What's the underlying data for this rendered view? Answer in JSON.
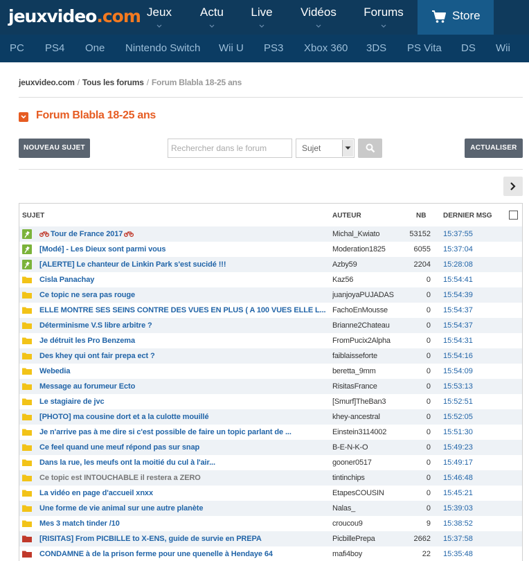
{
  "logo": {
    "main": "jeuxvideo",
    "accent": ".com"
  },
  "main_nav": [
    {
      "label": "Jeux"
    },
    {
      "label": "Actu"
    },
    {
      "label": "Live"
    },
    {
      "label": "Vidéos"
    },
    {
      "label": "Forums"
    }
  ],
  "store": {
    "label": "Store",
    "icon": "cart-icon"
  },
  "platforms": [
    "PC",
    "PS4",
    "One",
    "Nintendo Switch",
    "Wii U",
    "PS3",
    "Xbox 360",
    "3DS",
    "PS Vita",
    "DS",
    "Wii"
  ],
  "breadcrumb": {
    "home": "jeuxvideo.com",
    "forums": "Tous les forums",
    "current": "Forum Blabla 18-25 ans",
    "separator": "/"
  },
  "page_title": "Forum Blabla 18-25 ans",
  "toolbar": {
    "new_topic_label": "NOUVEAU SUJET",
    "search_placeholder": "Rechercher dans le forum",
    "search_scope": "Sujet",
    "refresh_label": "ACTUALISER"
  },
  "table": {
    "headers": {
      "subject": "SUJET",
      "author": "AUTEUR",
      "nb": "NB",
      "last": "DERNIER MSG"
    },
    "colors": {
      "pinned": "#7bb33a",
      "normal": "#f2c318",
      "hot": "#c0392b",
      "link": "#2265a8",
      "title_accent": "#e65c22"
    },
    "rows": [
      {
        "type": "pinned",
        "subject": "Tour de France 2017",
        "bike": true,
        "author": "Michal_Kwiato",
        "nb": "53152",
        "time": "15:37:55"
      },
      {
        "type": "pinned",
        "subject": "[Modé] - Les Dieux sont parmi vous",
        "author": "Moderation1825",
        "nb": "6055",
        "time": "15:37:04"
      },
      {
        "type": "pinned",
        "subject": "[ALERTE] Le chanteur de Linkin Park s'est sucidé !!!",
        "author": "Azby59",
        "nb": "2204",
        "time": "15:28:08"
      },
      {
        "type": "normal",
        "subject": "Cisla Panachay",
        "author": "Kaz56",
        "nb": "0",
        "time": "15:54:41"
      },
      {
        "type": "normal",
        "subject": "Ce topic ne sera pas rouge",
        "author": "juanjoyaPUJADAS",
        "nb": "0",
        "time": "15:54:39"
      },
      {
        "type": "normal",
        "subject": "ELLE MONTRE SES SEINS CONTRE DES VUES EN PLUS ( A 100 VUES ELLE L...",
        "author": "FachoEnMousse",
        "nb": "0",
        "time": "15:54:37"
      },
      {
        "type": "normal",
        "subject": "Déterminisme V.S libre arbitre ?",
        "author": "Brianne2Chateau",
        "nb": "0",
        "time": "15:54:37"
      },
      {
        "type": "normal",
        "subject": "Je détruit les Pro Benzema",
        "author": "FromPucix2Alpha",
        "nb": "0",
        "time": "15:54:31"
      },
      {
        "type": "normal",
        "subject": "Des khey qui ont fair prepa ect ?",
        "author": "faiblaisseforte",
        "nb": "0",
        "time": "15:54:16"
      },
      {
        "type": "normal",
        "subject": "Webedia",
        "author": "beretta_9mm",
        "nb": "0",
        "time": "15:54:09"
      },
      {
        "type": "normal",
        "subject": "Message au forumeur Ecto",
        "author": "RisitasFrance",
        "nb": "0",
        "time": "15:53:13"
      },
      {
        "type": "normal",
        "subject": "Le stagiaire de jvc",
        "author": "[Smurf]TheBan3",
        "nb": "0",
        "time": "15:52:51"
      },
      {
        "type": "normal",
        "subject": "[PHOTO] ma cousine dort et a la culotte mouillé",
        "author": "khey-ancestral",
        "nb": "0",
        "time": "15:52:05"
      },
      {
        "type": "normal",
        "subject": "Je n'arrive pas à me dire si c'est possible de faire un topic parlant de ...",
        "author": "Einstein3114002",
        "nb": "0",
        "time": "15:51:30"
      },
      {
        "type": "normal",
        "subject": "Ce feel quand une meuf répond pas sur snap",
        "author": "B-E-N-K-O",
        "nb": "0",
        "time": "15:49:23"
      },
      {
        "type": "normal",
        "subject": "Dans la rue, les meufs ont la moitié du cul à l'air...",
        "author": "gooner0517",
        "nb": "0",
        "time": "15:49:17"
      },
      {
        "type": "normal",
        "grey": true,
        "subject": "Ce topic est INTOUCHABLE il restera a ZERO",
        "author": "tintinchips",
        "nb": "0",
        "time": "15:46:48"
      },
      {
        "type": "normal",
        "subject": "La vidéo en page d'accueil xnxx",
        "author": "EtapesCOUSIN",
        "nb": "0",
        "time": "15:45:21"
      },
      {
        "type": "normal",
        "subject": "Une forme de vie animal sur une autre planète",
        "author": "Nalas_",
        "nb": "0",
        "time": "15:39:03"
      },
      {
        "type": "normal",
        "subject": "Mes 3 match tinder /10",
        "author": "croucou9",
        "nb": "9",
        "time": "15:38:52"
      },
      {
        "type": "hot",
        "subject": "[RISITAS] From PICBILLE to X-ENS, guide de survie en PREPA",
        "author": "PicbillePrepa",
        "nb": "2662",
        "time": "15:37:58"
      },
      {
        "type": "hot",
        "subject": "CONDAMNE à de la prison ferme pour une quenelle à Hendaye 64",
        "author": "mafi4boy",
        "nb": "22",
        "time": "15:35:48"
      }
    ]
  }
}
